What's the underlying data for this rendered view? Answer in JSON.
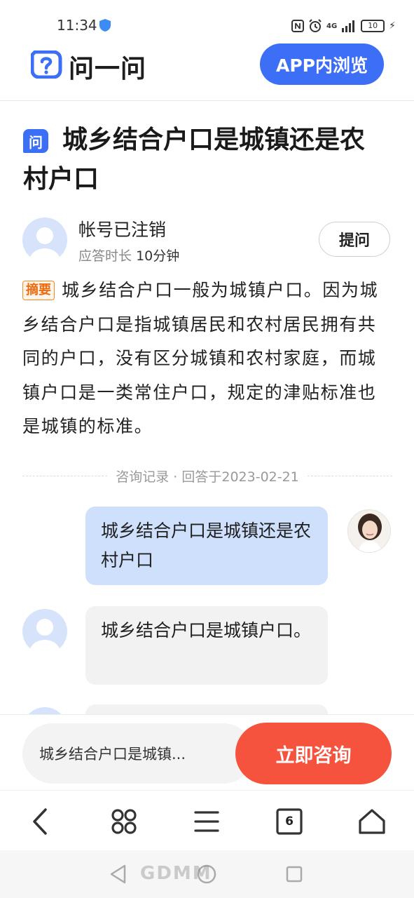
{
  "status_bar": {
    "time": "11:34",
    "network": "4G",
    "battery": "10"
  },
  "header": {
    "logo_text": "问一问",
    "app_button": "APP内浏览"
  },
  "question": {
    "badge": "问",
    "title": "城乡结合户口是城镇还是农村户口"
  },
  "author": {
    "name": "帐号已注销",
    "answer_time_label": "应答时长",
    "answer_time_value": "10分钟",
    "ask_button": "提问"
  },
  "summary": {
    "tag": "摘要",
    "text": "城乡结合户口一般为城镇户口。因为城乡结合户口是指城镇居民和农村居民拥有共同的户口，没有区分城镇和农村家庭，而城镇户口是一类常住户口，规定的津贴标准也是城镇的标准。"
  },
  "consult_record": {
    "label": "咨询记录 · 回答于2023-02-21"
  },
  "chat": [
    {
      "role": "user",
      "text": "城乡结合户口是城镇还是农村户口"
    },
    {
      "role": "bot",
      "text": "城乡结合户口是城镇户口。"
    }
  ],
  "consult_bar": {
    "input_text": "城乡结合户口是城镇...",
    "button": "立即咨询"
  },
  "browser_nav": {
    "tabs_count": "6"
  },
  "watermark": "GDMM",
  "colors": {
    "accent": "#3c6ef6",
    "consult_button": "#f5533e",
    "user_bubble": "#cfe0fc",
    "summary_tag": "#ee6a10"
  }
}
